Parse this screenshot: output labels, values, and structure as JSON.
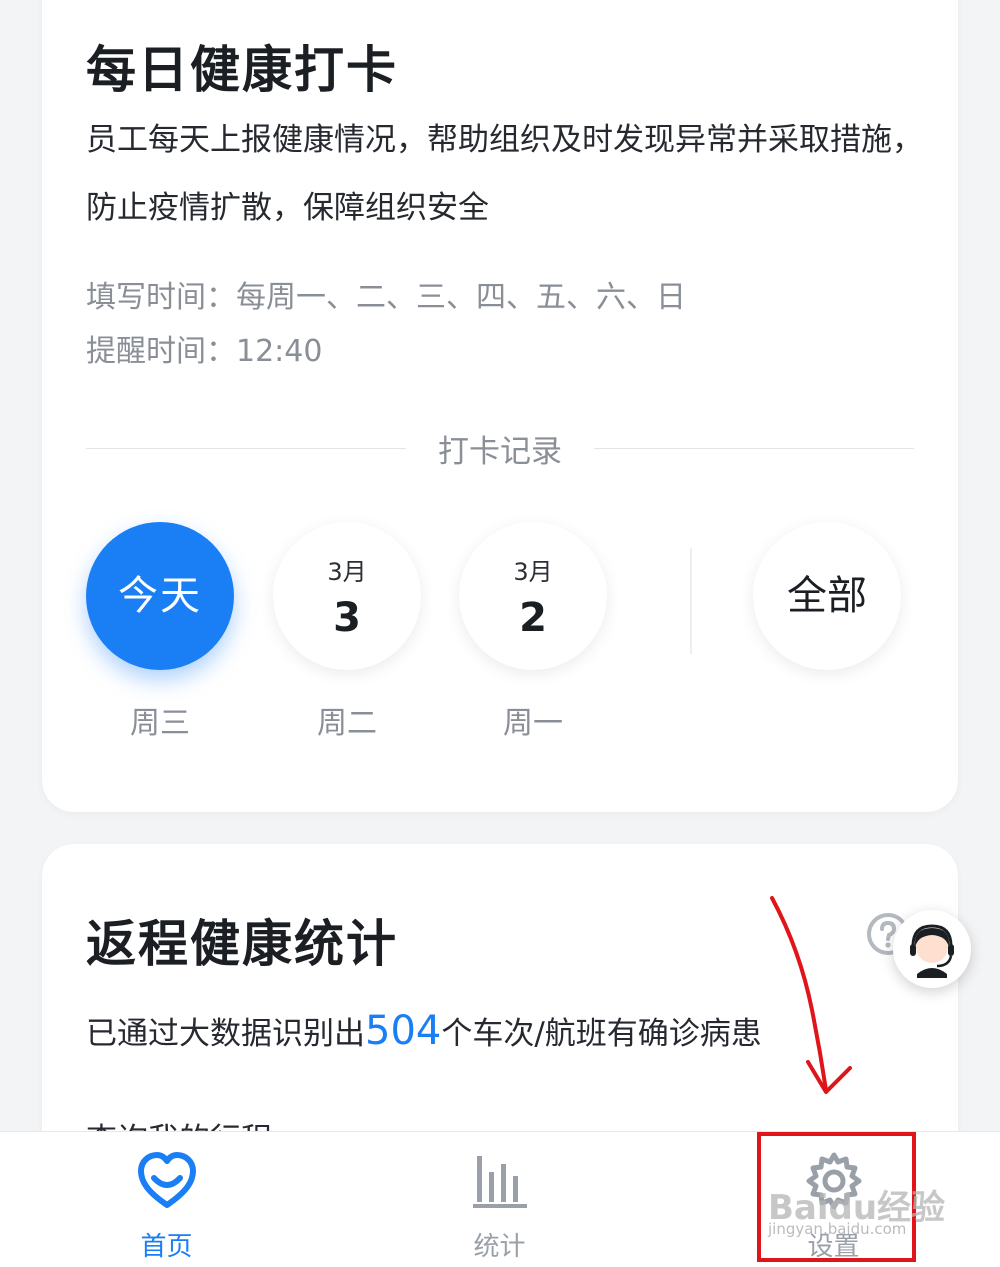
{
  "checkin_card": {
    "title": "每日健康打卡",
    "description": "员工每天上报健康情况，帮助组织及时发现异常并采取措施，防止疫情扩散，保障组织安全",
    "fill_time": "填写时间：每周一、二、三、四、五、六、日",
    "remind_time": "提醒时间：12:40",
    "records_label": "打卡记录",
    "days": [
      {
        "label": "今天",
        "weekday": "周三"
      },
      {
        "month": "3月",
        "date": "3",
        "weekday": "周二"
      },
      {
        "month": "3月",
        "date": "2",
        "weekday": "周一"
      }
    ],
    "all_label": "全部"
  },
  "return_card": {
    "title": "返程健康统计",
    "stat_prefix": "已通过大数据识别出",
    "stat_number": "504",
    "stat_suffix": "个车次/航班有确诊病患",
    "cut_text": "查询我的行程"
  },
  "tabbar": {
    "tabs": [
      {
        "label": "首页",
        "icon": "heart-icon",
        "active": true
      },
      {
        "label": "统计",
        "icon": "bar-chart-icon",
        "active": false
      },
      {
        "label": "设置",
        "icon": "gear-icon",
        "active": false
      }
    ]
  },
  "watermark": {
    "text": "Baidu经验",
    "sub": "jingyan.baidu.com"
  },
  "colors": {
    "accent": "#1a7ef5",
    "annotation": "#e0151a"
  }
}
